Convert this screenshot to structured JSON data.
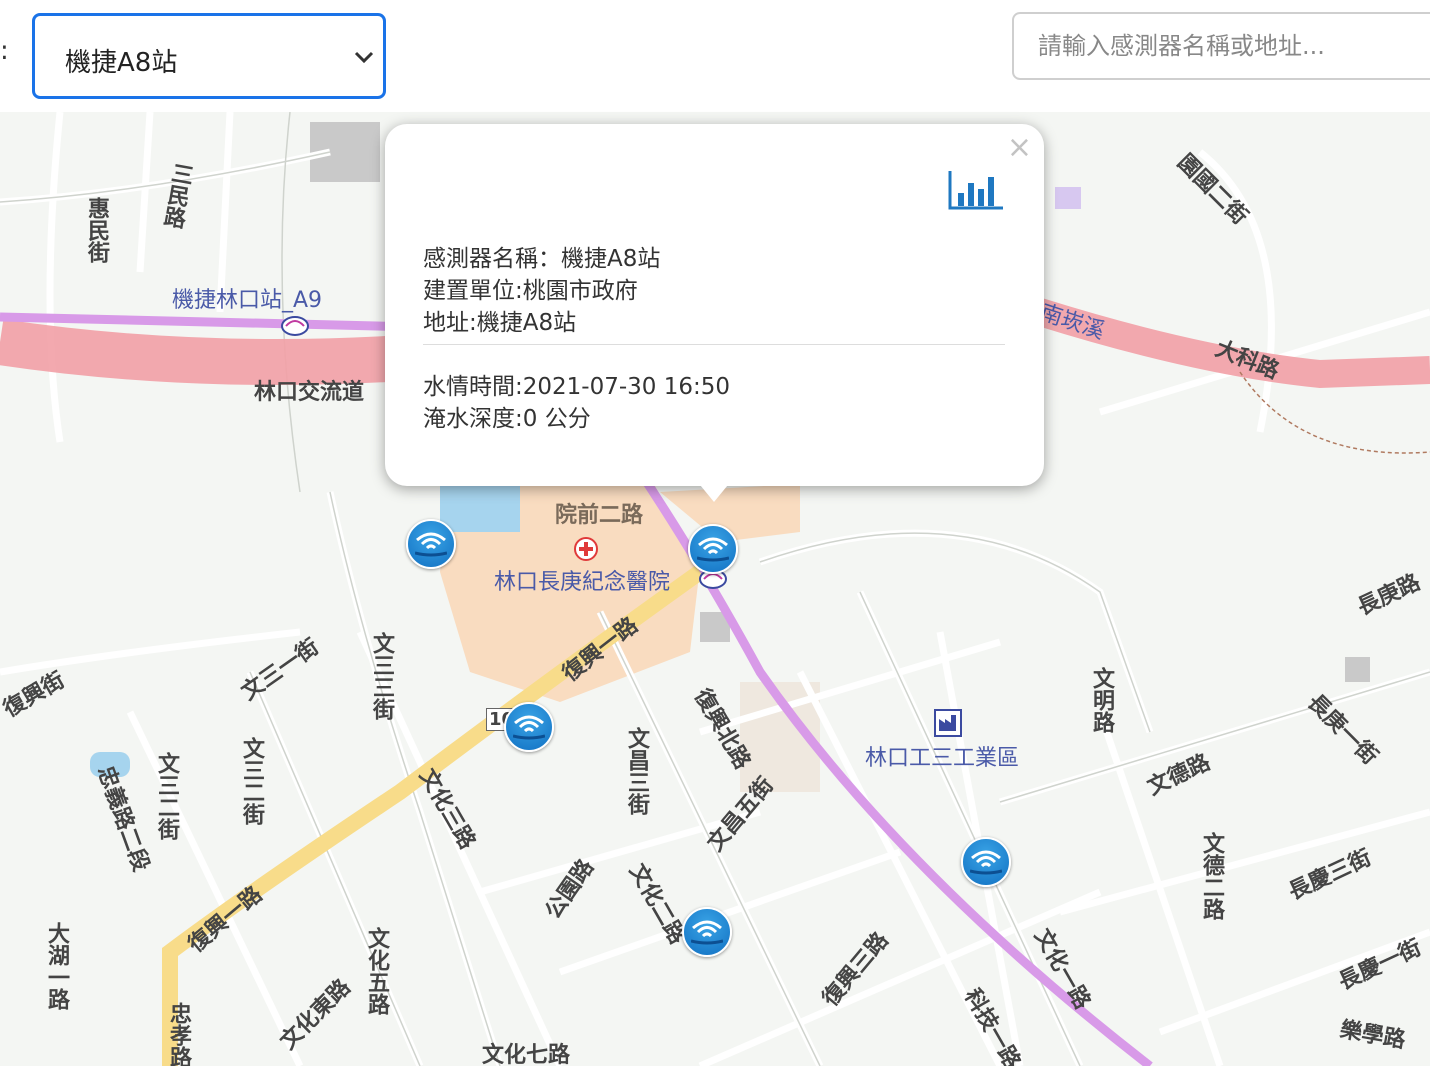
{
  "toolbar": {
    "colon": ":",
    "station_select": {
      "selected": "機捷A8站"
    },
    "search": {
      "placeholder": "請輸入感測器名稱或地址..."
    }
  },
  "map": {
    "labels": {
      "metro_a9": "機捷林口站_A9",
      "linkou_interchange": "林口交流道",
      "hospital": "林口長庚紀念醫院",
      "yuanqian2": "院前二路",
      "fuxing1_upper": "復興一路",
      "fuxing1_lower": "復興一路",
      "fuxingbei": "復興北路",
      "fuxing3": "復興三路",
      "fuxing_st": "復興街",
      "wensan1": "文三一街",
      "wensan3": "文三三街",
      "wensan2": "文三二街",
      "wenchang3": "文昌三街",
      "wenchang5": "文昌五街",
      "wenhua3": "文化三路",
      "wenhua2": "文化二路",
      "wenhua1": "文化一路",
      "wenhua5": "文化五路",
      "wenhua7": "文化七路",
      "wenhuadong": "文化東路",
      "gongyuan": "公園路",
      "linkou_industrial": "林口工三工業區",
      "wenming": "文明路",
      "wende": "文德路",
      "wende2": "文德二路",
      "changgeng": "長庚路",
      "changgeng1": "長庚一街",
      "changqing3": "長慶三街",
      "changqing1": "長慶一街",
      "lexue": "樂學路",
      "dake": "大科路",
      "nankan_river": "南崁溪",
      "zhongyi": "忠義路二段",
      "huimin": "惠民街",
      "minsan": "三民路",
      "dashen": "大湖一路",
      "keji": "科技一路",
      "route_marker": "10",
      "yuanguo2": "園國二街",
      "zhongxiao": "忠孝路"
    },
    "sensors": [
      "sensor-a8",
      "sensor-west",
      "sensor-fuxing",
      "sensor-wenhua2",
      "sensor-industrial"
    ]
  },
  "popup": {
    "sensor_name": "感測器名稱：機捷A8站",
    "builder": "建置單位:桃園市政府",
    "address": "地址:機捷A8站",
    "time": "水情時間:2021-07-30 16:50",
    "depth": "淹水深度:0 公分",
    "close": "×"
  },
  "colors": {
    "accent": "#1a73e8",
    "chart_icon": "#1f78c1",
    "sensor": "#1f7fd0",
    "highway": "#f2a0a6",
    "metro": "#d89ae8",
    "arterial": "#f8dc8a",
    "hospital_area": "#f9dcc0"
  }
}
